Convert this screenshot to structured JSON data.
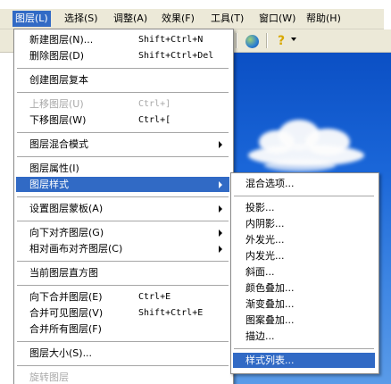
{
  "menubar": {
    "items": [
      {
        "label": "图层(L)",
        "active": true
      },
      {
        "label": "选择(S)",
        "active": false
      },
      {
        "label": "调整(A)",
        "active": false
      },
      {
        "label": "效果(F)",
        "active": false
      },
      {
        "label": "工具(T)",
        "active": false
      },
      {
        "label": "窗口(W)",
        "active": false
      },
      {
        "label": "帮助(H)",
        "active": false
      }
    ]
  },
  "toolbar": {
    "globe_icon": "globe-icon",
    "help_icon": "lightbulb-help-icon"
  },
  "layer_menu": {
    "items": [
      {
        "label": "新建图层(N)...",
        "shortcut": "Shift+Ctrl+N"
      },
      {
        "label": "删除图层(D)",
        "shortcut": "Shift+Ctrl+Del"
      },
      {
        "label": "创建图层复本",
        "shortcut": ""
      },
      {
        "label": "上移图层(U)",
        "shortcut": "Ctrl+]"
      },
      {
        "label": "下移图层(W)",
        "shortcut": "Ctrl+["
      },
      {
        "label": "图层混合模式",
        "shortcut": ""
      },
      {
        "label": "图层属性(I)",
        "shortcut": ""
      },
      {
        "label": "图层样式",
        "shortcut": ""
      },
      {
        "label": "设置图层蒙板(A)",
        "shortcut": ""
      },
      {
        "label": "向下对齐图层(G)",
        "shortcut": ""
      },
      {
        "label": "相对画布对齐图层(C)",
        "shortcut": ""
      },
      {
        "label": "当前图层直方图",
        "shortcut": ""
      },
      {
        "label": "向下合并图层(E)",
        "shortcut": "Ctrl+E"
      },
      {
        "label": "合并可见图层(V)",
        "shortcut": "Shift+Ctrl+E"
      },
      {
        "label": "合并所有图层(F)",
        "shortcut": ""
      },
      {
        "label": "图层大小(S)...",
        "shortcut": ""
      },
      {
        "label": "旋转图层",
        "shortcut": ""
      }
    ]
  },
  "layer_style_submenu": {
    "items": [
      {
        "label": "混合选项..."
      },
      {
        "label": "投影..."
      },
      {
        "label": "内阴影..."
      },
      {
        "label": "外发光..."
      },
      {
        "label": "内发光..."
      },
      {
        "label": "斜面..."
      },
      {
        "label": "颜色叠加..."
      },
      {
        "label": "渐变叠加..."
      },
      {
        "label": "图案叠加..."
      },
      {
        "label": "描边..."
      },
      {
        "label": "样式列表..."
      }
    ]
  },
  "colors": {
    "highlight": "#316ac5",
    "menubar_bg": "#ece9d8",
    "disabled_text": "#a9a9a9",
    "sky": "#1a66d8"
  }
}
